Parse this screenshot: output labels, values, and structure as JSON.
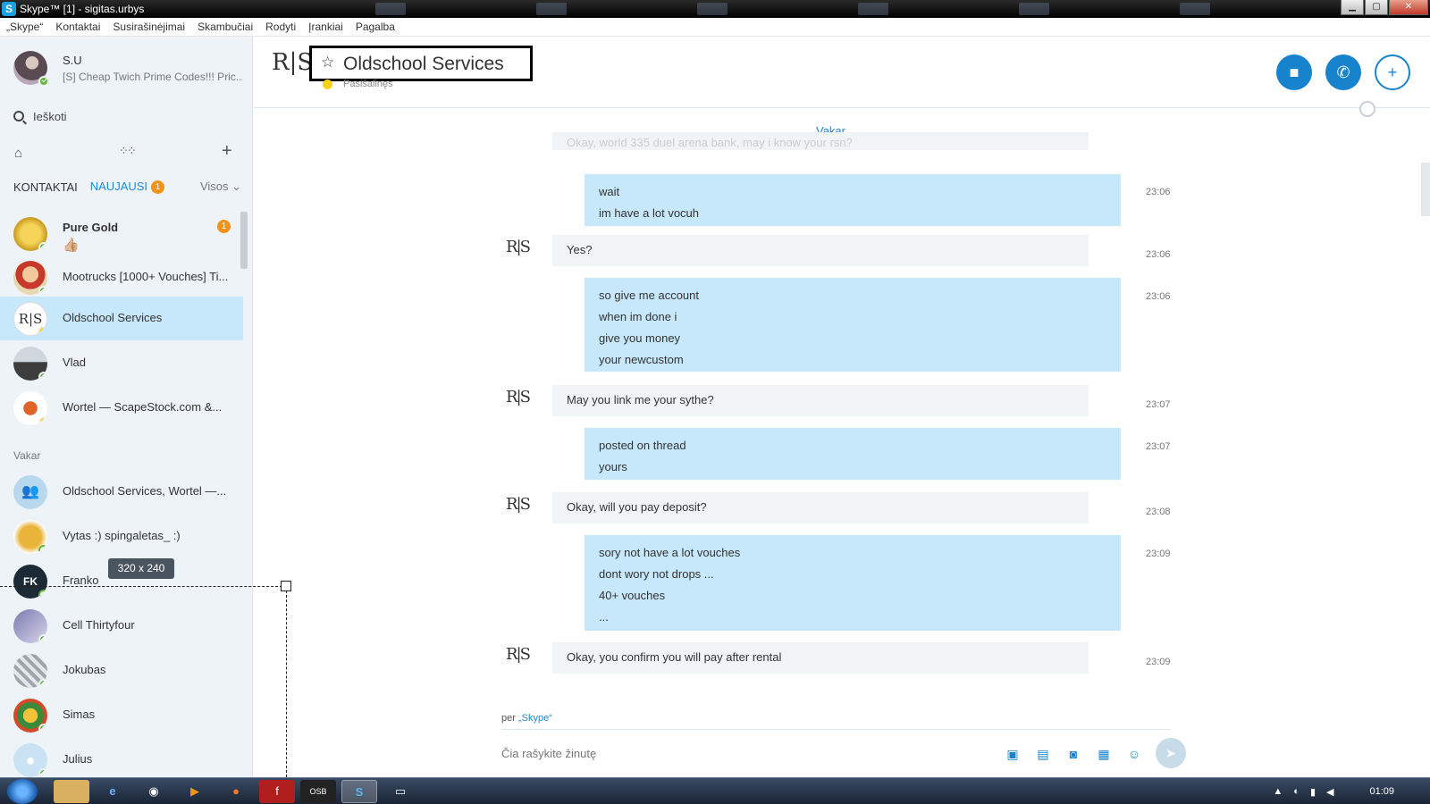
{
  "window": {
    "title": "Skype™ [1] - sigitas.urbys",
    "app_icon": "S",
    "minimize": "▁",
    "maximize": "▢",
    "close": "✕"
  },
  "menu": [
    "„Skype“",
    "Kontaktai",
    "Susirašinėjimai",
    "Skambučiai",
    "Rodyti",
    "Įrankiai",
    "Pagalba"
  ],
  "profile": {
    "name": "S.U",
    "mood": "[S] Cheap Twich Prime Codes!!! Pric..."
  },
  "search": {
    "placeholder": "Ieškoti"
  },
  "tabs": {
    "contacts": "KONTAKTAI",
    "recent": "NAUJAUSI",
    "recent_badge": "1",
    "filter": "Visos ⌄"
  },
  "section_yesterday": "Vakar",
  "contacts": [
    {
      "name": "Pure Gold",
      "sub": "👍🏼",
      "badge": "1",
      "status": "online",
      "bold": true
    },
    {
      "name": "Mootrucks [1000+ Vouches] Ti...",
      "status": "online"
    },
    {
      "name": "Oldschool Services",
      "status": "away",
      "selected": true
    },
    {
      "name": "Vlad",
      "status": "online"
    },
    {
      "name": "Wortel — ScapeStock.com &...",
      "status": "away"
    },
    {
      "name": "Oldschool Services, Wortel —...",
      "status": "group"
    },
    {
      "name": "Vytas :) spingaletas_ :)",
      "status": "offline"
    },
    {
      "name": "Franko",
      "status": "offline"
    },
    {
      "name": "Cell Thirtyfour",
      "status": "online"
    },
    {
      "name": "Jokubas",
      "status": "online"
    },
    {
      "name": "Simas",
      "status": "online"
    },
    {
      "name": "Julius",
      "status": "online"
    }
  ],
  "size_tooltip": "320 x 240",
  "chat": {
    "title": "Oldschool Services",
    "status": "Pasišalinęs",
    "day_label": "Vakar",
    "ghost_message": "Okay, world 335 duel arena bank, may i know your rsn?",
    "messages": [
      {
        "dir": "out",
        "lines": [
          "wait",
          "im have a lot vocuh"
        ],
        "time": "23:06"
      },
      {
        "dir": "in",
        "lines": [
          "Yes?"
        ],
        "time": "23:06"
      },
      {
        "dir": "out",
        "lines": [
          "so give me account",
          "when im done i",
          "give you money",
          "your newcustom"
        ],
        "time": "23:06"
      },
      {
        "dir": "in",
        "lines": [
          "May you link me your sythe?"
        ],
        "time": "23:07"
      },
      {
        "dir": "out",
        "lines": [
          "posted on thread",
          "yours"
        ],
        "time": "23:07"
      },
      {
        "dir": "in",
        "lines": [
          "Okay, will you pay deposit?"
        ],
        "time": "23:08"
      },
      {
        "dir": "out",
        "lines": [
          "sory not have a lot vouches",
          "dont wory not drops ...",
          "40+ vouches",
          "..."
        ],
        "time": "23:09"
      },
      {
        "dir": "in",
        "lines": [
          "Okay, you confirm you will pay after rental"
        ],
        "time": "23:09"
      }
    ],
    "via_prefix": "per",
    "via_link": "„Skype“",
    "compose_placeholder": "Čia rašykite žinutę"
  },
  "taskbar": {
    "clock": "01:09"
  },
  "colors": {
    "accent": "#1683cc",
    "out_bubble": "#c7e8fb",
    "in_bubble": "#f1f4f6",
    "sidebar_bg": "#eef3f8",
    "badge": "#f39218"
  }
}
